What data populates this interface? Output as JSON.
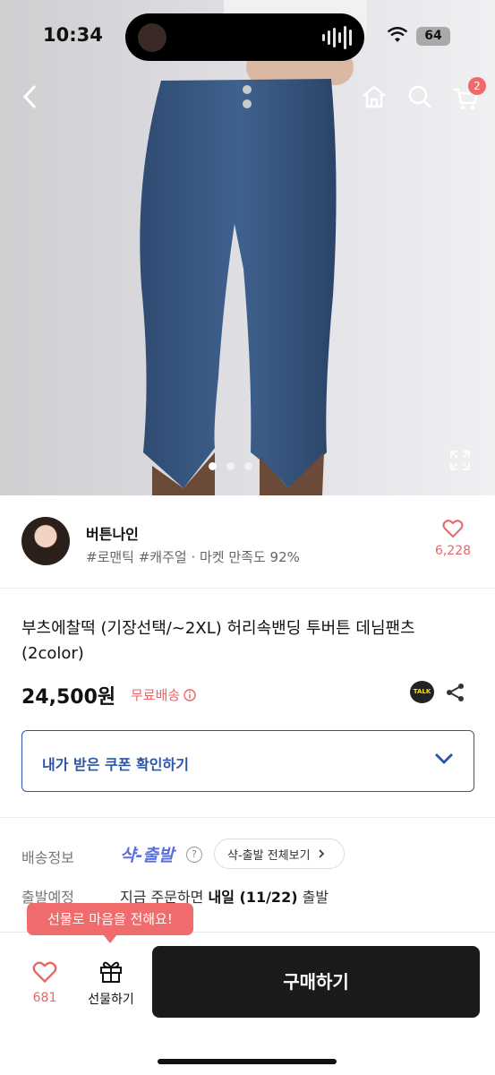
{
  "status_bar": {
    "time": "10:34",
    "battery": "64"
  },
  "hero": {
    "cart_badge": "2",
    "carousel_total": 4,
    "carousel_active": 1
  },
  "seller": {
    "name": "버튼나인",
    "tags": "#로맨틱 #캐주얼 · 마켓 만족도 92%",
    "like_count": "6,228"
  },
  "product": {
    "title": "부츠에찰떡 (기장선택/~2XL) 허리속밴딩 투버튼 데님팬츠 (2color)",
    "price": "24,500원",
    "free_shipping": "무료배송",
    "talk_label": "TALK"
  },
  "coupon": {
    "label": "내가 받은 쿠폰 확인하기"
  },
  "shipping": {
    "label": "배송정보",
    "logo": "샥-출발",
    "help": "?",
    "view_all": "샥-출발 전체보기",
    "departure_label": "출발예정",
    "departure_prefix": "지금 주문하면 ",
    "departure_bold": "내일 (11/22)",
    "departure_suffix": " 출발"
  },
  "bottom_bar": {
    "tooltip": "선물로 마음을 전해요!",
    "like_count": "681",
    "gift_label": "선물하기",
    "buy_label": "구매하기"
  },
  "colors": {
    "accent_red": "#e86666",
    "coupon_blue": "#2b56a8",
    "buy_button": "#1a1a1a"
  }
}
